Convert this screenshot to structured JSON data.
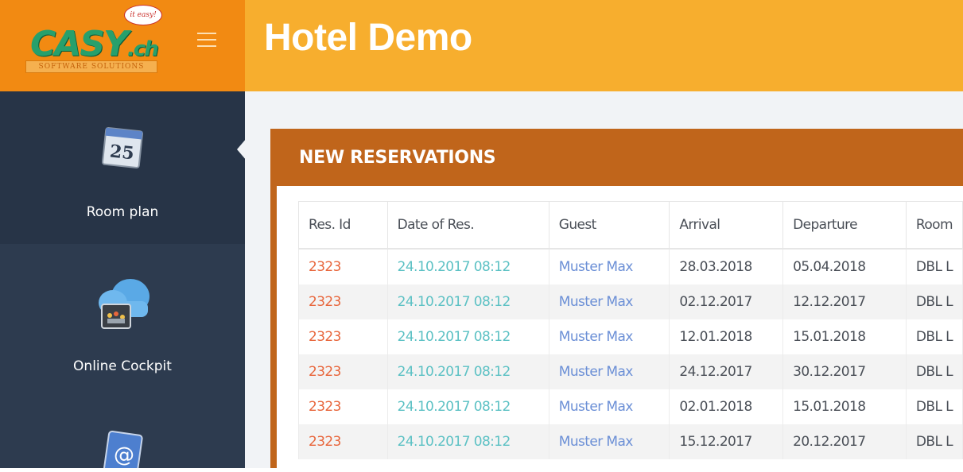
{
  "logo": {
    "brand": "CASY",
    "tld": ".ch",
    "tagline": "SOFTWARE SOLUTIONS",
    "bubble": "it easy!"
  },
  "header": {
    "title": "Hotel Demo"
  },
  "sidebar": {
    "items": [
      {
        "label": "Room plan",
        "icon": "calendar-icon",
        "calendar_day": "25",
        "active": true
      },
      {
        "label": "Online Cockpit",
        "icon": "cloud-cockpit-icon",
        "active": false
      },
      {
        "label": "",
        "icon": "email-icon",
        "active": false
      }
    ]
  },
  "panel": {
    "title": "NEW RESERVATIONS",
    "columns": [
      "Res. Id",
      "Date of Res.",
      "Guest",
      "Arrival",
      "Departure",
      "Room"
    ],
    "rows": [
      {
        "res_id": "2323",
        "date": "24.10.2017 08:12",
        "guest": "Muster Max",
        "arrival": "28.03.2018",
        "departure": "05.04.2018",
        "room": "DBL L"
      },
      {
        "res_id": "2323",
        "date": "24.10.2017 08:12",
        "guest": "Muster Max",
        "arrival": "02.12.2017",
        "departure": "12.12.2017",
        "room": "DBL L"
      },
      {
        "res_id": "2323",
        "date": "24.10.2017 08:12",
        "guest": "Muster Max",
        "arrival": "12.01.2018",
        "departure": "15.01.2018",
        "room": "DBL L"
      },
      {
        "res_id": "2323",
        "date": "24.10.2017 08:12",
        "guest": "Muster Max",
        "arrival": "24.12.2017",
        "departure": "30.12.2017",
        "room": "DBL L"
      },
      {
        "res_id": "2323",
        "date": "24.10.2017 08:12",
        "guest": "Muster Max",
        "arrival": "02.01.2018",
        "departure": "15.01.2018",
        "room": "DBL L"
      },
      {
        "res_id": "2323",
        "date": "24.10.2017 08:12",
        "guest": "Muster Max",
        "arrival": "15.12.2017",
        "departure": "20.12.2017",
        "room": "DBL L"
      }
    ]
  },
  "colors": {
    "logo_bg": "#f28a12",
    "header_bg": "#f7ae2e",
    "sidebar_bg": "#2d3b4f",
    "panel_header": "#c0651b",
    "res_id": "#e8663c",
    "date": "#5cc1c4",
    "guest": "#6b8fd6"
  }
}
